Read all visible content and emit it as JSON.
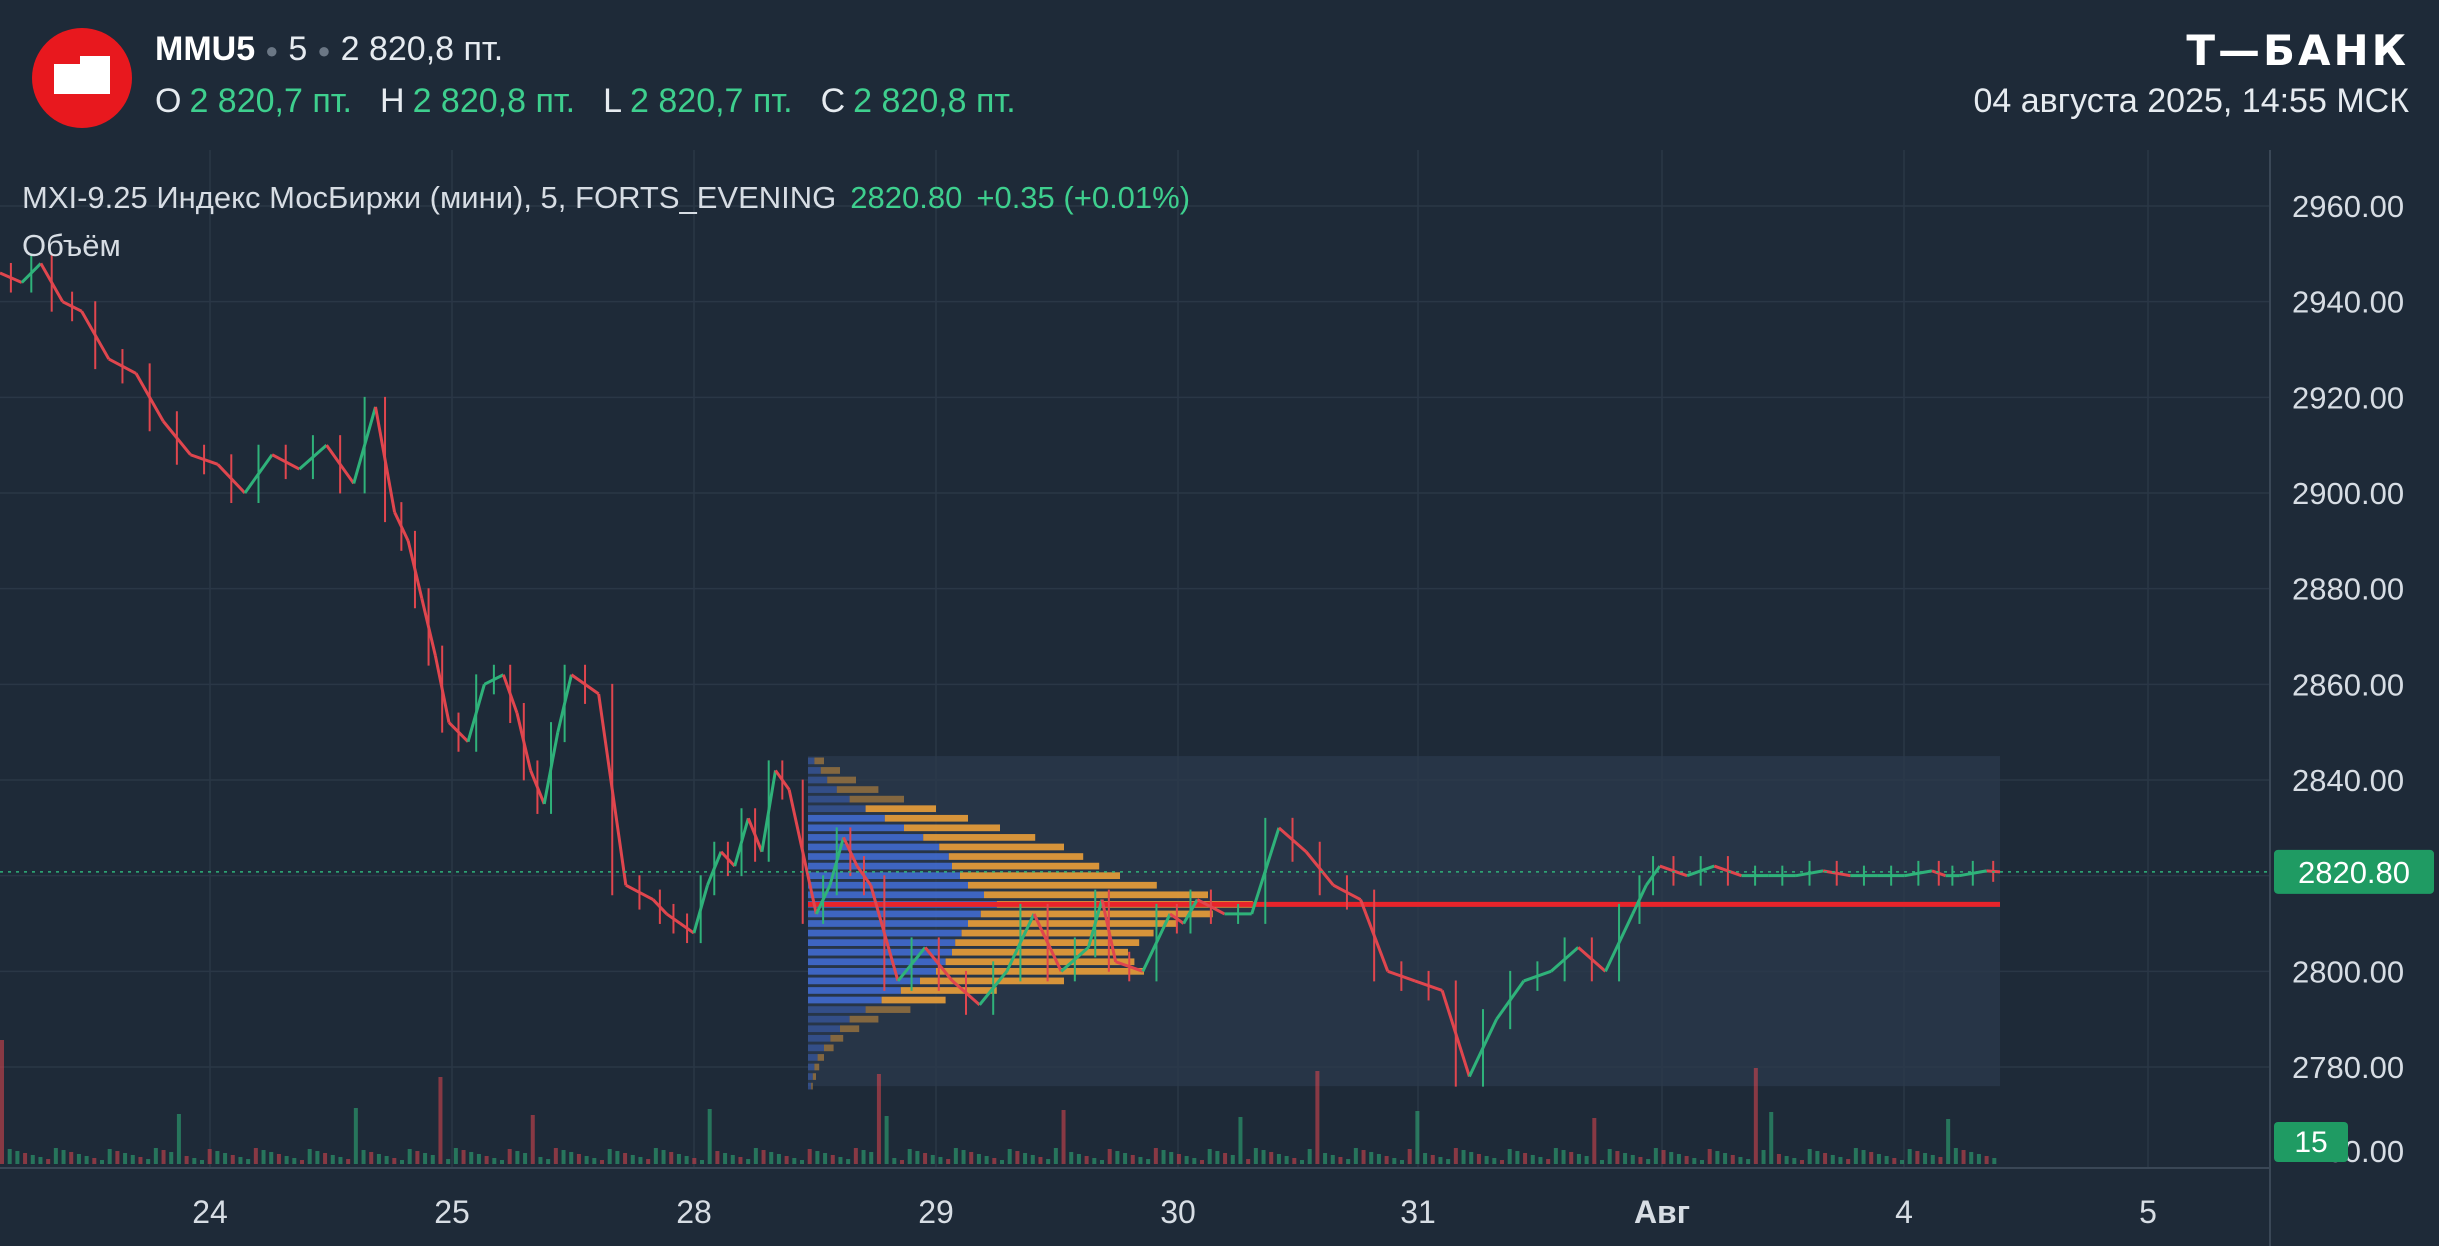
{
  "header": {
    "symbol": "MMU5",
    "interval": "5",
    "last": "2 820,8 пт.",
    "ohlc": [
      {
        "key": "O",
        "value": "2 820,7 пт."
      },
      {
        "key": "H",
        "value": "2 820,8 пт."
      },
      {
        "key": "L",
        "value": "2 820,7 пт."
      },
      {
        "key": "C",
        "value": "2 820,8 пт."
      }
    ],
    "brand": "Т—БАНК",
    "datetime": "04 августа 2025, 14:55 МСК"
  },
  "legend": {
    "instrument": "MXI-9.25 Индекс МосБиржи (мини), 5, FORTS_EVENING",
    "price": "2820.80",
    "change": "+0.35 (+0.01%)",
    "volume_label": "Объём"
  },
  "colors": {
    "background": "#1e2a38",
    "up": "#2fb27a",
    "down": "#e0464e",
    "profile_blue": "#3f68c8",
    "profile_orange": "#e09a3a",
    "poc_line": "#e8242b",
    "price_tag": "#1f9b63",
    "logo_red": "#e8181e"
  },
  "chart_data": {
    "type": "line",
    "title": "",
    "y_axis": {
      "min": 2750,
      "max": 2970,
      "ticks": [
        "2960.00",
        "2940.00",
        "2920.00",
        "2900.00",
        "2880.00",
        "2860.00",
        "2840.00",
        "2820.00",
        "2800.00",
        "2780.00"
      ]
    },
    "x_axis": {
      "ticks": [
        "24",
        "25",
        "28",
        "29",
        "30",
        "31",
        "Авг",
        "4",
        "5"
      ]
    },
    "current_price": {
      "value": 2820.8,
      "label": "2820.80"
    },
    "volume_tag": "15",
    "partial_tick": "2760.00",
    "poc_level": 2814,
    "series": [
      {
        "x": [
          0,
          0.08,
          0.15,
          0.23,
          0.3,
          0.4,
          0.5,
          0.6,
          0.7,
          0.8,
          0.9,
          1.0,
          1.1,
          1.2,
          1.3,
          1.38,
          1.45,
          1.5,
          1.55,
          1.6,
          1.65,
          1.72,
          1.78,
          1.85,
          1.9,
          1.95,
          2.0,
          2.05,
          2.1,
          2.2,
          2.3,
          2.4,
          2.45,
          2.5,
          2.55,
          2.6,
          2.65,
          2.7,
          2.75,
          2.8,
          2.85,
          2.9,
          3.0,
          3.05,
          3.1,
          3.15,
          3.2,
          3.3,
          3.4,
          3.5,
          3.6,
          3.7,
          3.8,
          3.9,
          4.0,
          4.05,
          4.1,
          4.2,
          4.3,
          4.35,
          4.4,
          4.5,
          4.6,
          4.7,
          4.8,
          4.9,
          5.0,
          5.1,
          5.2,
          5.3,
          5.4,
          5.5,
          5.6,
          5.7,
          5.8,
          5.9,
          6.0,
          6.05,
          6.1,
          6.2,
          6.3,
          6.4,
          6.5,
          6.6,
          6.7,
          6.8,
          6.9,
          7.0,
          7.1,
          7.15,
          7.2,
          7.3,
          7.35
        ],
        "y": [
          2946,
          2944,
          2948,
          2940,
          2938,
          2928,
          2925,
          2915,
          2908,
          2906,
          2900,
          2908,
          2905,
          2910,
          2902,
          2918,
          2896,
          2890,
          2878,
          2866,
          2852,
          2848,
          2860,
          2862,
          2854,
          2842,
          2835,
          2850,
          2862,
          2858,
          2818,
          2815,
          2812,
          2810,
          2808,
          2818,
          2825,
          2822,
          2832,
          2825,
          2842,
          2838,
          2812,
          2818,
          2828,
          2822,
          2818,
          2798,
          2805,
          2798,
          2793,
          2800,
          2812,
          2800,
          2805,
          2815,
          2802,
          2800,
          2812,
          2810,
          2815,
          2812,
          2812,
          2830,
          2825,
          2818,
          2815,
          2800,
          2798,
          2796,
          2778,
          2790,
          2798,
          2800,
          2805,
          2800,
          2812,
          2818,
          2822,
          2820,
          2822,
          2820,
          2820,
          2820,
          2821,
          2820,
          2820,
          2820,
          2821,
          2820,
          2820,
          2821,
          2820.8
        ]
      }
    ],
    "volume_profile": {
      "from_x": 2.45,
      "to_x": 7.35,
      "top": 2845,
      "bottom": 2776,
      "levels": [
        2844,
        2842,
        2840,
        2838,
        2836,
        2834,
        2832,
        2830,
        2828,
        2826,
        2824,
        2822,
        2820,
        2818,
        2816,
        2814,
        2812,
        2810,
        2808,
        2806,
        2804,
        2802,
        2800,
        2798,
        2796,
        2794,
        2792,
        2790,
        2788,
        2786,
        2784,
        2782,
        2780,
        2778,
        2776
      ],
      "blue": [
        4,
        8,
        12,
        18,
        26,
        36,
        48,
        60,
        72,
        82,
        88,
        90,
        95,
        100,
        110,
        118,
        108,
        100,
        96,
        92,
        90,
        86,
        80,
        70,
        58,
        46,
        36,
        26,
        20,
        14,
        10,
        6,
        4,
        3,
        2
      ],
      "orange": [
        6,
        12,
        18,
        26,
        34,
        44,
        52,
        60,
        70,
        78,
        84,
        92,
        100,
        118,
        140,
        160,
        145,
        130,
        120,
        115,
        110,
        118,
        130,
        90,
        60,
        40,
        28,
        18,
        12,
        8,
        6,
        4,
        3,
        2,
        1
      ]
    }
  }
}
